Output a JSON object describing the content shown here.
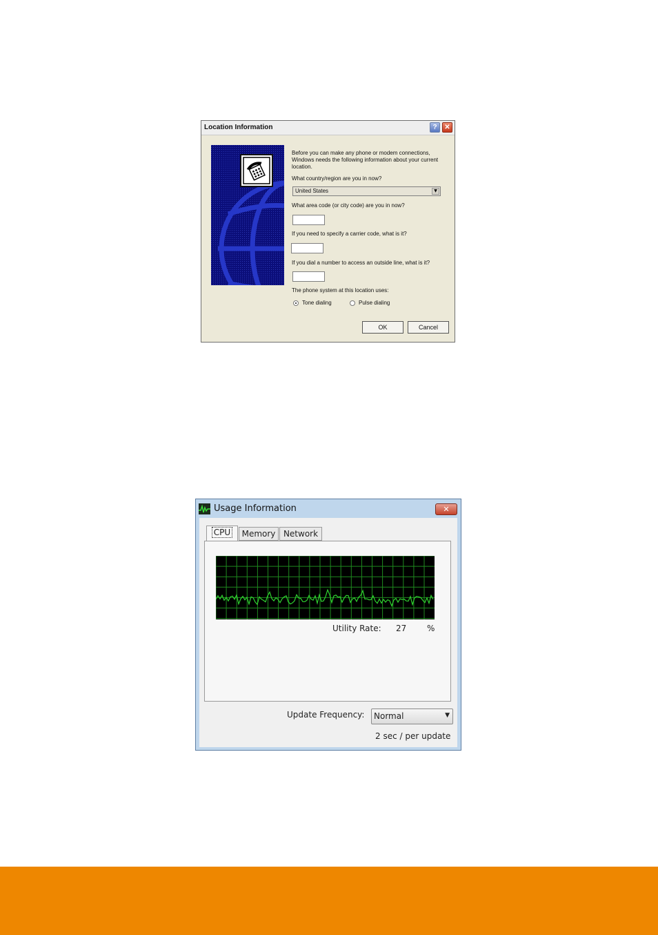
{
  "location_dialog": {
    "title": "Location Information",
    "help_glyph": "?",
    "close_glyph": "✕",
    "intro_line1": "Before you can make any phone or modem connections,",
    "intro_line2": "Windows needs the following information about your current",
    "intro_line3": "location.",
    "country_question": "What country/region are you in now?",
    "country_value": "United States",
    "area_question": "What area code (or city code) are you in now?",
    "carrier_question": "If you need to specify a carrier code, what is it?",
    "outside_line_question": "If you dial a number to access an outside line, what is it?",
    "phone_system_label": "The phone system at this location uses:",
    "tone_label": "Tone dialing",
    "pulse_label": "Pulse dialing",
    "ok_label": "OK",
    "cancel_label": "Cancel"
  },
  "usage_window": {
    "title": "Usage Information",
    "close_glyph": "✕",
    "tabs": [
      "CPU",
      "Memory",
      "Network"
    ],
    "active_tab": "CPU",
    "utility_rate_label": "Utility Rate:",
    "utility_rate_value": "27",
    "utility_rate_unit": "%",
    "update_frequency_label": "Update Frequency:",
    "update_frequency_value": "Normal",
    "update_note": "2 sec / per update",
    "graph_color": "#2fd12f",
    "grid_color": "#1f8a1f"
  },
  "footer": {
    "color": "#ee8700"
  }
}
